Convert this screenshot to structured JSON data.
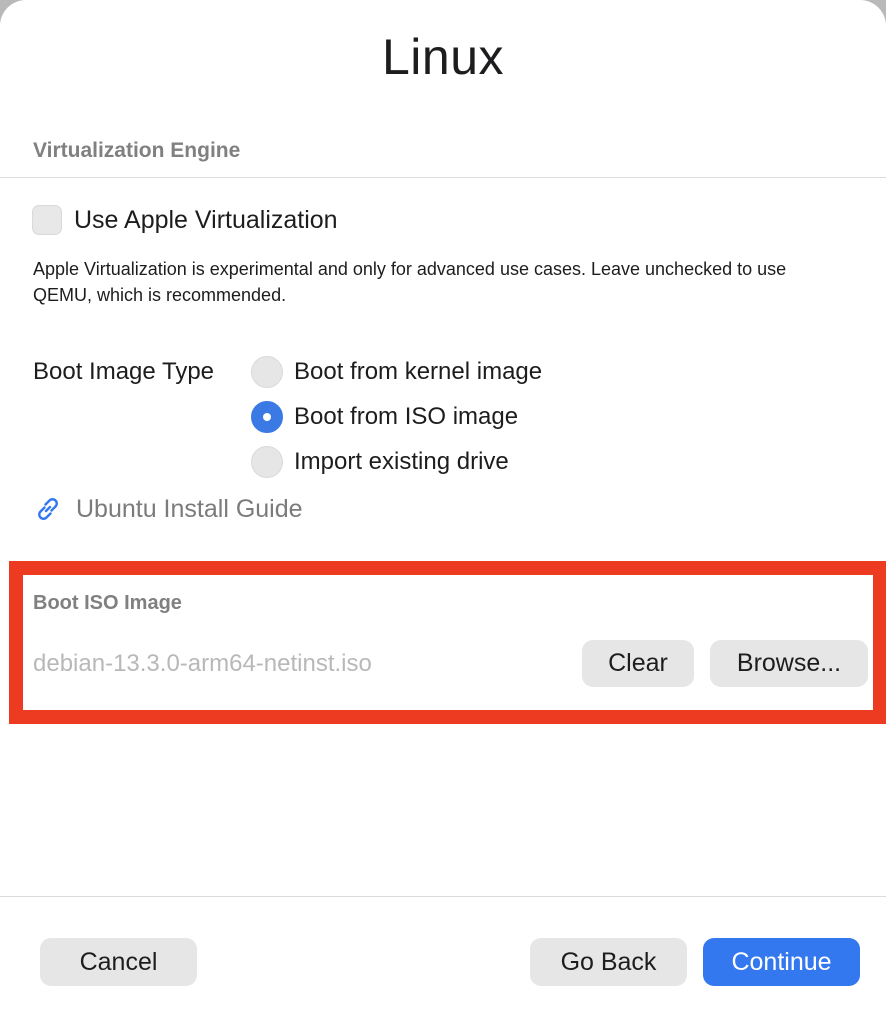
{
  "window": {
    "title": "Linux"
  },
  "virtualization": {
    "section_label": "Virtualization Engine",
    "checkbox_label": "Use Apple Virtualization",
    "checkbox_checked": false,
    "description": "Apple Virtualization is experimental and only for advanced use cases. Leave unchecked to use QEMU, which is recommended."
  },
  "boot_image_type": {
    "label": "Boot Image Type",
    "options": [
      {
        "label": "Boot from kernel image",
        "selected": false
      },
      {
        "label": "Boot from ISO image",
        "selected": true
      },
      {
        "label": "Import existing drive",
        "selected": false
      }
    ]
  },
  "guide": {
    "label": "Ubuntu Install Guide",
    "icon": "link-icon"
  },
  "boot_iso": {
    "section_label": "Boot ISO Image",
    "path": "debian-13.3.0-arm64-netinst.iso",
    "clear_label": "Clear",
    "browse_label": "Browse..."
  },
  "footer": {
    "cancel_label": "Cancel",
    "back_label": "Go Back",
    "continue_label": "Continue"
  },
  "colors": {
    "accent": "#3478f0",
    "highlight": "#ec3b21"
  }
}
